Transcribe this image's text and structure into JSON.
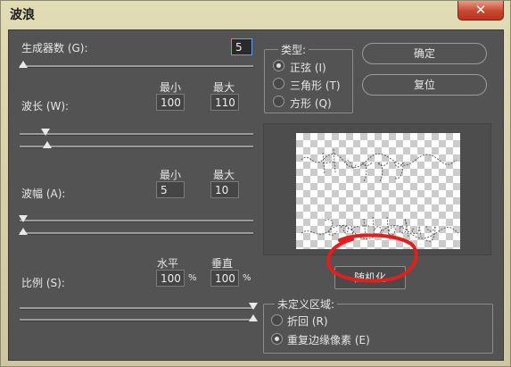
{
  "window": {
    "title": "波浪",
    "close_glyph": "✕"
  },
  "generators": {
    "label": "生成器数 (G):",
    "value": "5"
  },
  "wavelength": {
    "label": "波长 (W):",
    "min_label": "最小",
    "max_label": "最大",
    "min": "100",
    "max": "110"
  },
  "amplitude": {
    "label": "波幅 (A):",
    "min_label": "最小",
    "max_label": "最大",
    "min": "5",
    "max": "10"
  },
  "scale": {
    "label": "比例 (S):",
    "h_label": "水平",
    "v_label": "垂直",
    "h": "100",
    "v": "100",
    "unit": "%"
  },
  "type_group": {
    "title": "类型:",
    "options": [
      "正弦 (I)",
      "三角形 (T)",
      "方形 (Q)"
    ],
    "selected_index": 0
  },
  "buttons": {
    "ok": "确定",
    "reset": "复位",
    "randomize": "随机化"
  },
  "undefined_area": {
    "title": "未定义区域:",
    "options": [
      "折回 (R)",
      "重复边缘像素 (E)"
    ],
    "selected_index": 1
  },
  "annotation_color": "#e01f1f"
}
